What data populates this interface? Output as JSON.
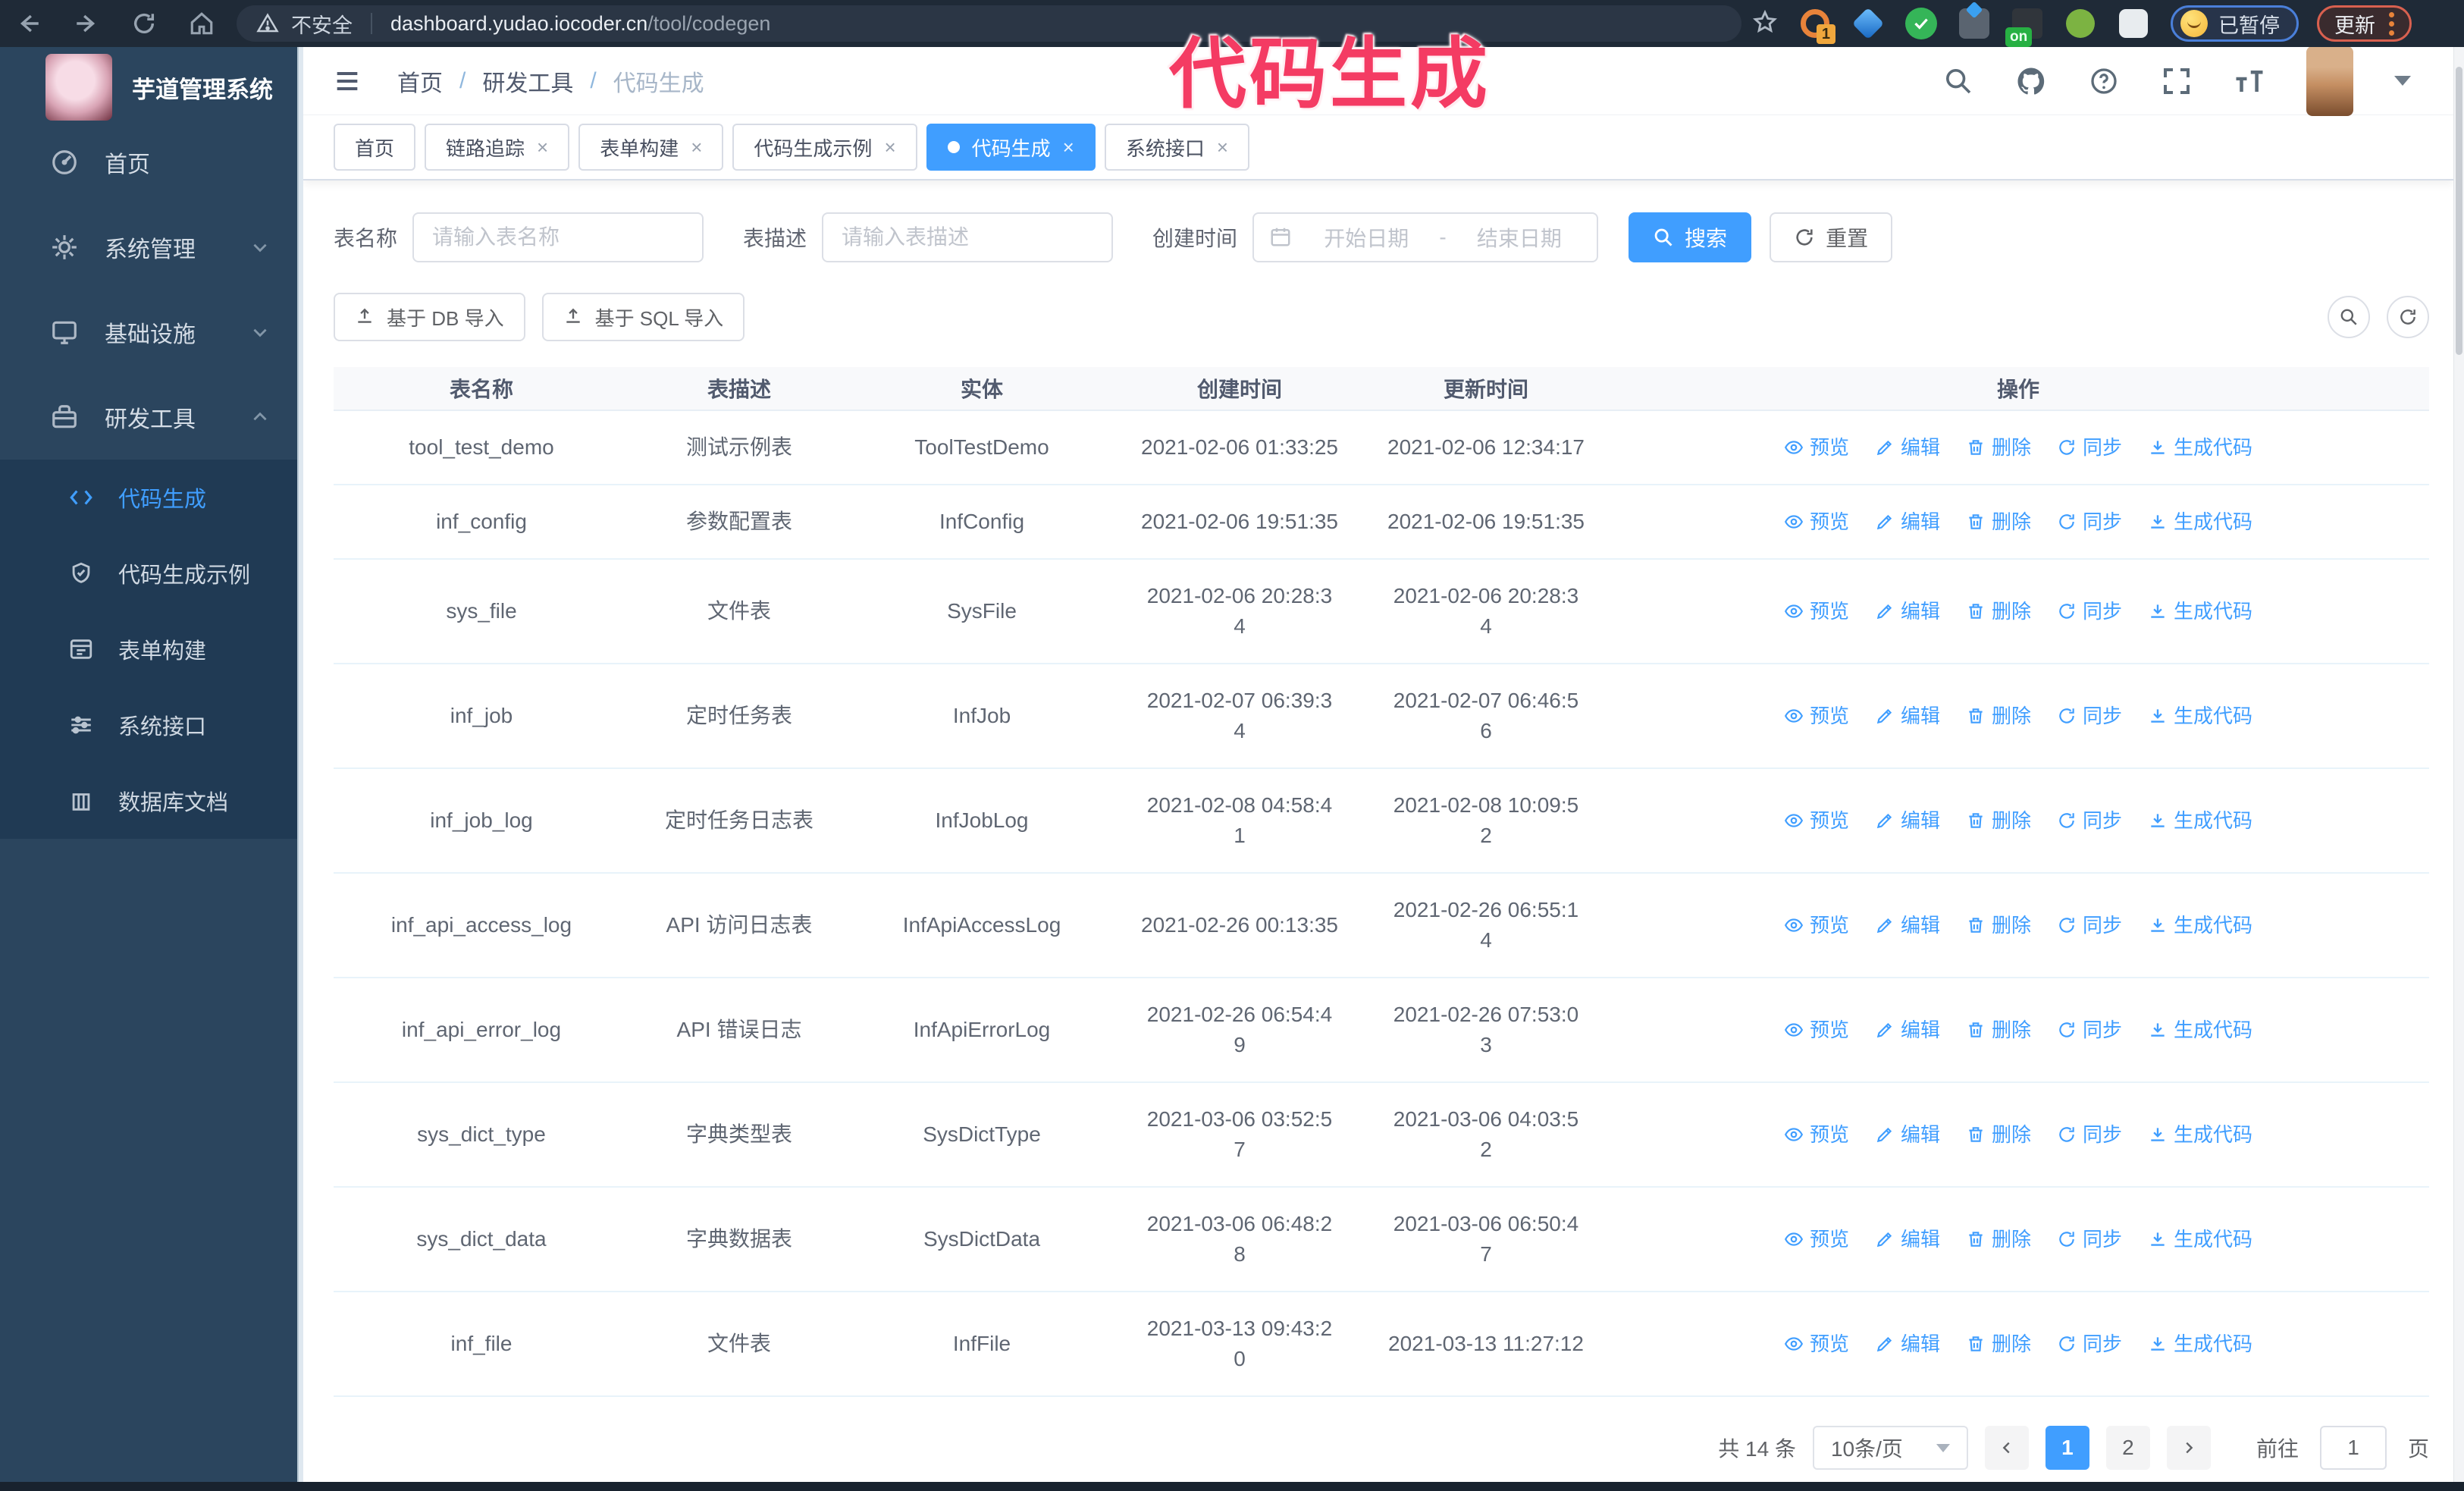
{
  "overlay_title": "代码生成",
  "browser": {
    "security_label": "不安全",
    "url_domain": "dashboard.yudao.iocoder.cn",
    "url_path": "/tool/codegen",
    "ext_badge_1": "1",
    "ext_badge_on": "on",
    "paused_badge": "已暂停",
    "update_button": "更新"
  },
  "sidebar": {
    "logo_title": "芋道管理系统",
    "items": [
      {
        "label": "首页",
        "icon": "dashboard-icon",
        "chevron": false
      },
      {
        "label": "系统管理",
        "icon": "gear-icon",
        "chevron": "down"
      },
      {
        "label": "基础设施",
        "icon": "monitor-icon",
        "chevron": "down"
      },
      {
        "label": "研发工具",
        "icon": "toolbox-icon",
        "chevron": "up",
        "expanded": true
      }
    ],
    "submenu": [
      {
        "label": "代码生成",
        "icon": "code-icon",
        "active": true
      },
      {
        "label": "代码生成示例",
        "icon": "shield-check-icon",
        "active": false
      },
      {
        "label": "表单构建",
        "icon": "form-icon",
        "active": false
      },
      {
        "label": "系统接口",
        "icon": "sliders-icon",
        "active": false
      },
      {
        "label": "数据库文档",
        "icon": "database-icon",
        "active": false
      }
    ]
  },
  "header": {
    "breadcrumb": [
      "首页",
      "研发工具",
      "代码生成"
    ],
    "breadcrumb_separator": "/"
  },
  "ui": {
    "close_glyph": "×"
  },
  "tabs": [
    {
      "label": "首页",
      "closable": false,
      "active": false
    },
    {
      "label": "链路追踪",
      "closable": true,
      "active": false
    },
    {
      "label": "表单构建",
      "closable": true,
      "active": false
    },
    {
      "label": "代码生成示例",
      "closable": true,
      "active": false
    },
    {
      "label": "代码生成",
      "closable": true,
      "active": true
    },
    {
      "label": "系统接口",
      "closable": true,
      "active": false
    }
  ],
  "filters": {
    "table_name_label": "表名称",
    "table_name_placeholder": "请输入表名称",
    "table_desc_label": "表描述",
    "table_desc_placeholder": "请输入表描述",
    "create_time_label": "创建时间",
    "date_start_placeholder": "开始日期",
    "date_separator": "-",
    "date_end_placeholder": "结束日期",
    "search_button": "搜索",
    "reset_button": "重置"
  },
  "toolbar": {
    "import_db": "基于 DB 导入",
    "import_sql": "基于 SQL 导入"
  },
  "table": {
    "columns": [
      "表名称",
      "表描述",
      "实体",
      "创建时间",
      "更新时间",
      "操作"
    ],
    "actions": [
      "预览",
      "编辑",
      "删除",
      "同步",
      "生成代码"
    ],
    "rows": [
      {
        "name": "tool_test_demo",
        "desc": "测试示例表",
        "entity": "ToolTestDemo",
        "create_time": "2021-02-06 01:33:25",
        "update_time": "2021-02-06 12:34:17"
      },
      {
        "name": "inf_config",
        "desc": "参数配置表",
        "entity": "InfConfig",
        "create_time": "2021-02-06 19:51:35",
        "update_time": "2021-02-06 19:51:35"
      },
      {
        "name": "sys_file",
        "desc": "文件表",
        "entity": "SysFile",
        "create_time": "2021-02-06 20:28:3\n4",
        "update_time": "2021-02-06 20:28:3\n4"
      },
      {
        "name": "inf_job",
        "desc": "定时任务表",
        "entity": "InfJob",
        "create_time": "2021-02-07 06:39:3\n4",
        "update_time": "2021-02-07 06:46:5\n6"
      },
      {
        "name": "inf_job_log",
        "desc": "定时任务日志表",
        "entity": "InfJobLog",
        "create_time": "2021-02-08 04:58:4\n1",
        "update_time": "2021-02-08 10:09:5\n2"
      },
      {
        "name": "inf_api_access_log",
        "desc": "API 访问日志表",
        "entity": "InfApiAccessLog",
        "create_time": "2021-02-26 00:13:35",
        "update_time": "2021-02-26 06:55:1\n4"
      },
      {
        "name": "inf_api_error_log",
        "desc": "API 错误日志",
        "entity": "InfApiErrorLog",
        "create_time": "2021-02-26 06:54:4\n9",
        "update_time": "2021-02-26 07:53:0\n3"
      },
      {
        "name": "sys_dict_type",
        "desc": "字典类型表",
        "entity": "SysDictType",
        "create_time": "2021-03-06 03:52:5\n7",
        "update_time": "2021-03-06 04:03:5\n2"
      },
      {
        "name": "sys_dict_data",
        "desc": "字典数据表",
        "entity": "SysDictData",
        "create_time": "2021-03-06 06:48:2\n8",
        "update_time": "2021-03-06 06:50:4\n7"
      },
      {
        "name": "inf_file",
        "desc": "文件表",
        "entity": "InfFile",
        "create_time": "2021-03-13 09:43:2\n0",
        "update_time": "2021-03-13 11:27:12"
      }
    ]
  },
  "pagination": {
    "total_text": "共 14 条",
    "page_size": "10条/页",
    "pages": [
      {
        "label": "1",
        "active": true
      },
      {
        "label": "2",
        "active": false
      }
    ],
    "goto_label": "前往",
    "goto_value": "1",
    "goto_suffix": "页"
  },
  "colors": {
    "accent_blue": "#409eff",
    "overlay_pink": "#f43b63",
    "topbar_bg": "#1f2a37",
    "sidebar_bg": "#2b455e",
    "submenu_bg": "#203a54",
    "link_blue": "#409eff"
  }
}
